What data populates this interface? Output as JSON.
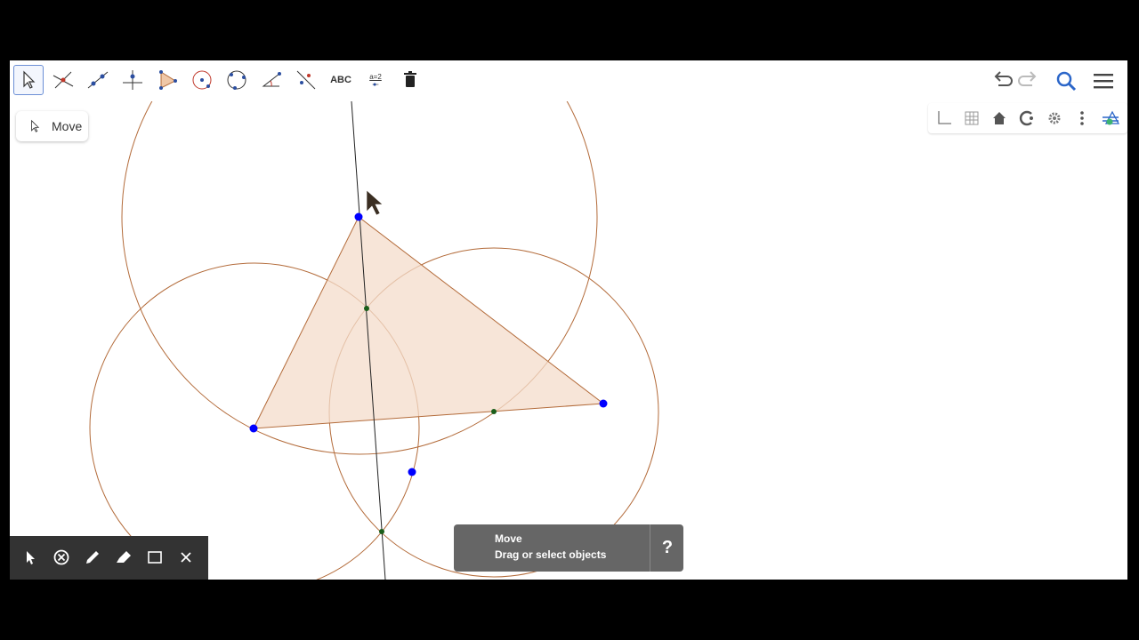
{
  "toolbar": {
    "tools": [
      {
        "name": "move-tool",
        "icon": "arrow-icon",
        "selected": true
      },
      {
        "name": "point-tool",
        "icon": "point-on-lines-icon"
      },
      {
        "name": "line-tool",
        "icon": "line-icon"
      },
      {
        "name": "perpendicular-line-tool",
        "icon": "perpendicular-icon"
      },
      {
        "name": "polygon-tool",
        "icon": "polygon-icon"
      },
      {
        "name": "circle-tool",
        "icon": "circle-icon"
      },
      {
        "name": "conic-tool",
        "icon": "circle-through-points-icon"
      },
      {
        "name": "angle-tool",
        "icon": "angle-icon"
      },
      {
        "name": "reflect-tool",
        "icon": "reflect-icon"
      },
      {
        "name": "text-tool",
        "icon": "text-icon",
        "label": "ABC"
      },
      {
        "name": "slider-tool",
        "icon": "slider-icon",
        "label": "a=2"
      },
      {
        "name": "delete-tool",
        "icon": "trash-icon"
      }
    ],
    "right_icons": [
      "undo-icon",
      "redo-icon",
      "search-icon",
      "menu-icon"
    ]
  },
  "tooltip": {
    "label": "Move",
    "icon": "arrow-icon"
  },
  "style_bar": {
    "icons": [
      "axes-icon",
      "grid-icon",
      "home-icon",
      "view-icon",
      "gear-icon",
      "more-icon",
      "graphics-icon"
    ]
  },
  "pen_bar": {
    "icons": [
      "pointer-icon",
      "eraser-icon",
      "pen-icon",
      "highlighter-icon",
      "rectangle-icon",
      "close-icon"
    ]
  },
  "snackbar": {
    "title": "Move",
    "text": "Drag or select objects",
    "help": "?"
  },
  "colors": {
    "accent": "#6b8fd6",
    "circle": "#b36b3a",
    "fill": "#f4dccb",
    "point": "#0000ff",
    "intersection": "#1a5e1a"
  }
}
